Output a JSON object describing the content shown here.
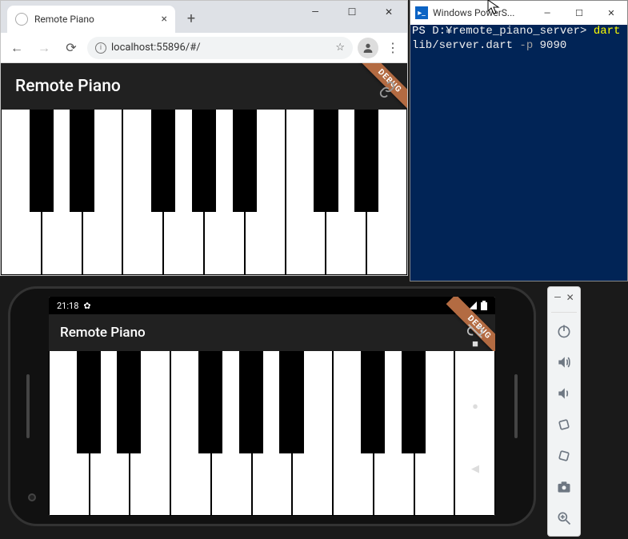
{
  "chrome": {
    "tab_title": "Remote Piano",
    "new_tab": "+",
    "tab_close": "×",
    "win_min": "—",
    "win_max": "☐",
    "win_close": "✕",
    "back": "←",
    "forward": "→",
    "reload": "⟳",
    "info": "i",
    "url": "localhost:55896/#/",
    "star": "☆",
    "profile": "👤",
    "menu": "⋮"
  },
  "flutter_web": {
    "title": "Remote Piano",
    "debug": "DEBUG"
  },
  "powershell": {
    "title": "Windows PowerS...",
    "prompt": "PS ",
    "cwd": "D:¥remote_piano_server>",
    "cmd": " dart",
    "arg1": " lib/server.dart",
    "flag": " -p",
    "port": " 9090",
    "win_min": "—",
    "win_max": "☐",
    "win_close": "✕",
    "icon_glyph": "▸_"
  },
  "phone": {
    "time": "21:18",
    "gear": "✿",
    "title": "Remote Piano",
    "debug": "DEBUG",
    "nav": {
      "square": "■",
      "circle": "●",
      "back": "◀"
    }
  },
  "emu_tools": {
    "min": "—",
    "close": "✕"
  },
  "piano": {
    "white_count": 10,
    "black_positions_pct": [
      7.0,
      17.0,
      37.0,
      47.0,
      57.0,
      77.0,
      87.0
    ],
    "black_width_pct": 6.0
  },
  "phone_piano": {
    "white_count": 11,
    "black_positions_pct": [
      6.2,
      15.3,
      33.5,
      42.6,
      51.7,
      69.9,
      79.0
    ],
    "black_width_pct": 5.4
  }
}
